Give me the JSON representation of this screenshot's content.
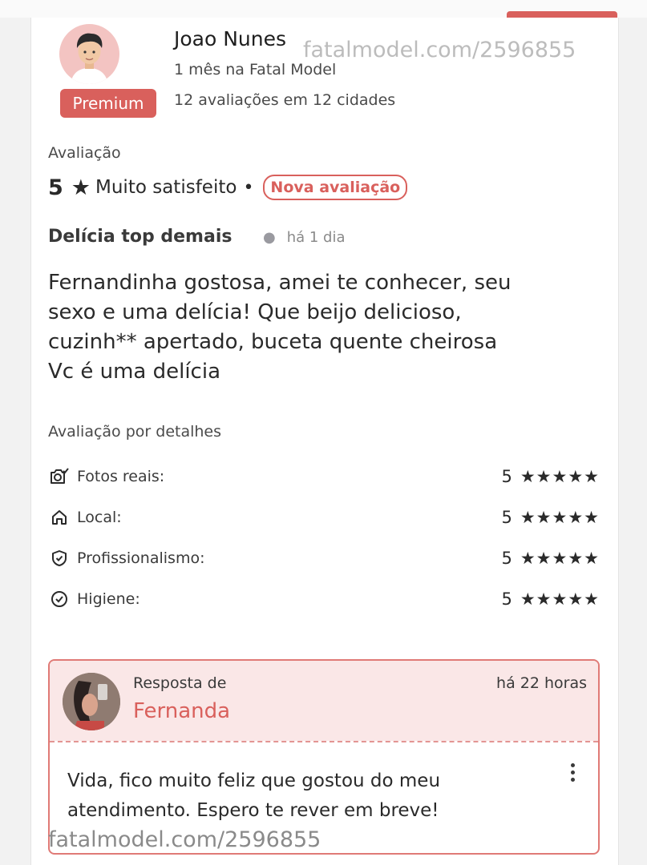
{
  "watermark_text": "fatalmodel.com/2596855",
  "reviewer": {
    "name": "Joao Nunes",
    "membership": "1 mês na Fatal Model",
    "badge": "Premium",
    "stats": "12 avaliações em 12 cidades",
    "avatar_icon": "male-avatar-icon"
  },
  "rating": {
    "label": "Avaliação",
    "score": "5",
    "star_icon": "★",
    "text": "Muito satisfeito",
    "separator": "•",
    "badge": "Nova avaliação"
  },
  "review": {
    "title": "Delícia top demais",
    "time": "há 1 dia",
    "body": "Fernandinha gostosa, amei te conhecer, seu\nsexo e uma delícia! Que beijo delicioso,\ncuzinh** apertado, buceta quente cheirosa\nVc é uma delícia"
  },
  "details": {
    "title": "Avaliação por detalhes",
    "items": [
      {
        "icon": "camera-check-icon",
        "label": "Fotos reais:",
        "score": "5",
        "stars": "★★★★★",
        "stars_count": 5
      },
      {
        "icon": "home-icon",
        "label": "Local:",
        "score": "5",
        "stars": "★★★★★",
        "stars_count": 5
      },
      {
        "icon": "shield-check-icon",
        "label": "Profissionalismo:",
        "score": "5",
        "stars": "★★★★★",
        "stars_count": 5
      },
      {
        "icon": "circle-check-icon",
        "label": "Higiene:",
        "score": "5",
        "stars": "★★★★★",
        "stars_count": 5
      }
    ]
  },
  "reply": {
    "label": "Resposta de",
    "name": "Fernanda",
    "time": "há 22 horas",
    "text": "Vida, fico muito feliz que gostou do meu\natendimento. Espero te rever em breve!",
    "menu_icon": "kebab-menu-icon"
  },
  "colors": {
    "accent": "#d9605c",
    "reply_bg": "#fae7e7",
    "text": "#2a2a2a"
  }
}
